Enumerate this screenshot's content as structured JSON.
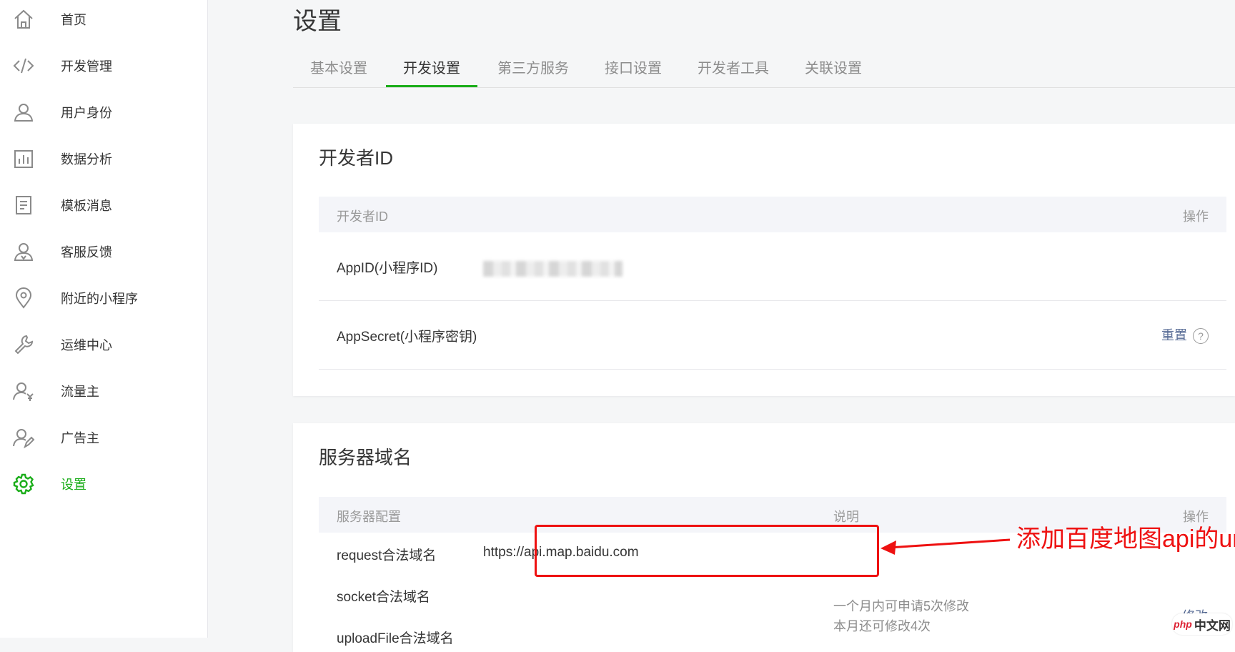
{
  "sidebar": {
    "items": [
      {
        "label": "首页",
        "icon": "home-icon"
      },
      {
        "label": "开发管理",
        "icon": "code-icon"
      },
      {
        "label": "用户身份",
        "icon": "user-icon"
      },
      {
        "label": "数据分析",
        "icon": "bar-chart-icon"
      },
      {
        "label": "模板消息",
        "icon": "document-icon"
      },
      {
        "label": "客服反馈",
        "icon": "customer-service-icon"
      },
      {
        "label": "附近的小程序",
        "icon": "location-pin-icon"
      },
      {
        "label": "运维中心",
        "icon": "wrench-icon"
      },
      {
        "label": "流量主",
        "icon": "user-yen-icon"
      },
      {
        "label": "广告主",
        "icon": "user-edit-icon"
      },
      {
        "label": "设置",
        "icon": "gear-icon"
      }
    ],
    "active_index": 10,
    "active_color": "#1aad19"
  },
  "page": {
    "title": "设置"
  },
  "tabs": [
    {
      "label": "基本设置"
    },
    {
      "label": "开发设置",
      "active": true
    },
    {
      "label": "第三方服务"
    },
    {
      "label": "接口设置"
    },
    {
      "label": "开发者工具"
    },
    {
      "label": "关联设置"
    }
  ],
  "developer_id": {
    "title": "开发者ID",
    "columns": [
      "开发者ID",
      "操作"
    ],
    "rows": [
      {
        "label": "AppID(小程序ID)",
        "value": "(blurred)",
        "action": ""
      },
      {
        "label": "AppSecret(小程序密钥)",
        "value": "",
        "action": "重置"
      }
    ]
  },
  "server_domain": {
    "title": "服务器域名",
    "columns": [
      "服务器配置",
      "说明",
      "操作"
    ],
    "rows": [
      {
        "label": "request合法域名",
        "value": "https://api.map.baidu.com"
      },
      {
        "label": "socket合法域名",
        "value": ""
      },
      {
        "label": "uploadFile合法域名",
        "value": ""
      }
    ],
    "notes": [
      "一个月内可申请5次修改",
      "本月还可修改4次"
    ],
    "action": "修改"
  },
  "annotation": {
    "text": "添加百度地图api的url",
    "color": "#ee1111"
  },
  "watermark": {
    "php": "php",
    "cn": "中文网"
  }
}
